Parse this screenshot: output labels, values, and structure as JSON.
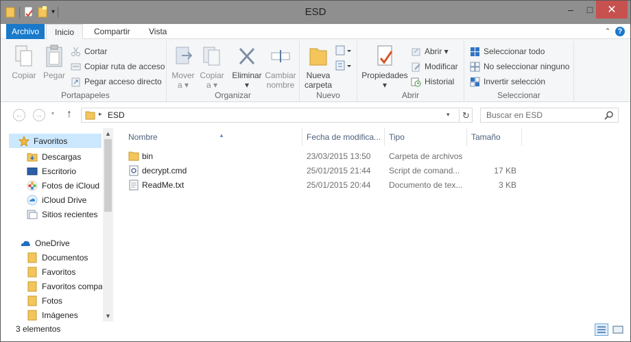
{
  "window": {
    "title": "ESD",
    "controls": {
      "minimize": "–",
      "maximize": "□",
      "close": "✕"
    }
  },
  "tabs": [
    {
      "label": "Archivo"
    },
    {
      "label": "Inicio"
    },
    {
      "label": "Compartir"
    },
    {
      "label": "Vista"
    }
  ],
  "ribbon": {
    "portapapeles": {
      "label": "Portapapeles",
      "copiar": "Copiar",
      "pegar": "Pegar",
      "cortar": "Cortar",
      "copiar_ruta": "Copiar ruta de acceso",
      "pegar_acceso": "Pegar acceso directo"
    },
    "organizar": {
      "label": "Organizar",
      "mover": "Mover",
      "mover_sub": "a ▾",
      "copiar": "Copiar",
      "copiar_sub": "a ▾",
      "eliminar": "Eliminar",
      "eliminar_sub": "▾",
      "cambiar": "Cambiar",
      "cambiar_sub": "nombre"
    },
    "nuevo": {
      "label": "Nuevo",
      "nueva": "Nueva",
      "nueva_sub": "carpeta"
    },
    "abrir": {
      "label": "Abrir",
      "propiedades": "Propiedades",
      "propiedades_sub": "▾",
      "abrir": "Abrir ▾",
      "modificar": "Modificar",
      "historial": "Historial"
    },
    "seleccionar": {
      "label": "Seleccionar",
      "todo": "Seleccionar todo",
      "ninguno": "No seleccionar ninguno",
      "invertir": "Invertir selección"
    }
  },
  "address": {
    "path": "ESD",
    "search_placeholder": "Buscar en ESD"
  },
  "navpane": {
    "favoritos": "Favoritos",
    "items": [
      {
        "label": "Descargas"
      },
      {
        "label": "Escritorio"
      },
      {
        "label": "Fotos de iCloud"
      },
      {
        "label": "iCloud Drive"
      },
      {
        "label": "Sitios recientes"
      }
    ],
    "onedrive": "OneDrive",
    "onedrive_items": [
      {
        "label": "Documentos"
      },
      {
        "label": "Favoritos"
      },
      {
        "label": "Favoritos compa"
      },
      {
        "label": "Fotos"
      },
      {
        "label": "Imágenes"
      }
    ]
  },
  "filelist": {
    "columns": {
      "name": "Nombre",
      "date": "Fecha de modifica...",
      "type": "Tipo",
      "size": "Tamaño"
    },
    "rows": [
      {
        "name": "bin",
        "date": "23/03/2015 13:50",
        "type": "Carpeta de archivos",
        "size": ""
      },
      {
        "name": "decrypt.cmd",
        "date": "25/01/2015 21:44",
        "type": "Script de comand...",
        "size": "17 KB"
      },
      {
        "name": "ReadMe.txt",
        "date": "25/01/2015 20:44",
        "type": "Documento de tex...",
        "size": "3 KB"
      }
    ]
  },
  "status": {
    "count": "3 elementos"
  },
  "colors": {
    "accent": "#1979ca",
    "titlebar": "#8f8f8f",
    "close": "#c7514f",
    "selection": "#cce8ff",
    "folder": "#f3c55b"
  }
}
